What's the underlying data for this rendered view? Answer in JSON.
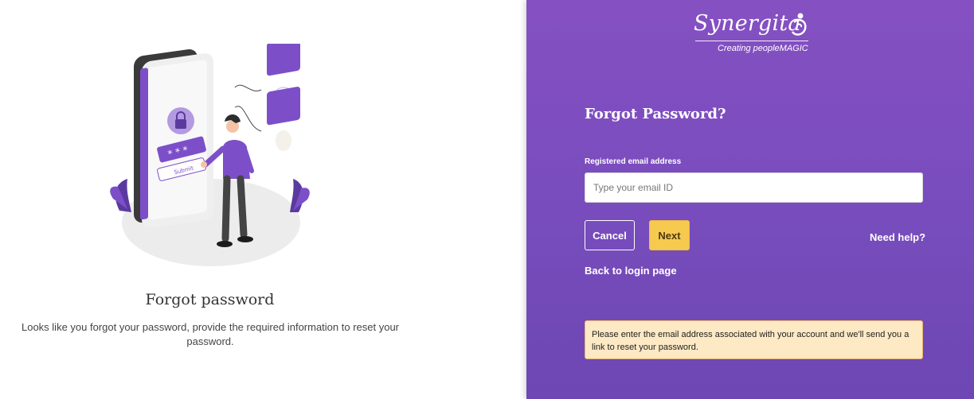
{
  "illustration": {
    "name": "forgot-password-illustration",
    "button_text": "Submit",
    "colors": {
      "accent": "#7c4fc9",
      "light_accent": "#b49ae0",
      "phone_dark": "#3a3a3a",
      "floor": "#ececec"
    }
  },
  "left": {
    "title": "Forgot password",
    "description": "Looks like you forgot your password, provide the required information to reset your password."
  },
  "brand": {
    "name": "Synergita",
    "tagline": "Creating peopleMAGIC"
  },
  "form": {
    "title": "Forgot Password?",
    "email_label": "Registered email address",
    "email_placeholder": "Type your email ID",
    "email_value": "",
    "cancel_label": "Cancel",
    "next_label": "Next",
    "need_help_label": "Need help?",
    "back_to_login_label": "Back to login page",
    "info_message": "Please enter the email address associated with your account and we'll send you a link to reset your password."
  },
  "colors": {
    "panel_top": "#8550c2",
    "panel_bottom": "#6d47b3",
    "next_button": "#f6c94f",
    "info_background": "#fde9c4",
    "info_border": "#e8b46a"
  }
}
